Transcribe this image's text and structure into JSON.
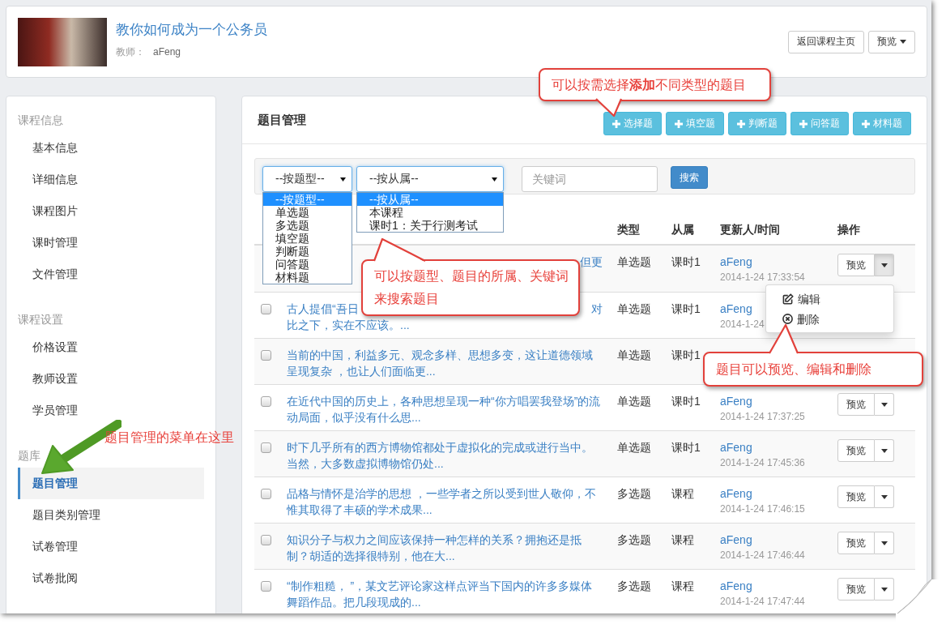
{
  "header": {
    "title": "教你如何成为一个公务员",
    "teacher_label": "教师：",
    "teacher": "aFeng",
    "buttons": [
      {
        "kind": "plain",
        "label": "返回课程主页"
      },
      {
        "kind": "dropdown",
        "label": "预览"
      }
    ]
  },
  "sidebar": {
    "groups": [
      {
        "heading": "课程信息",
        "items": [
          {
            "label": "基本信息",
            "selected": false
          },
          {
            "label": "详细信息",
            "selected": false
          },
          {
            "label": "课程图片",
            "selected": false
          },
          {
            "label": "课时管理",
            "selected": false
          },
          {
            "label": "文件管理",
            "selected": false
          }
        ]
      },
      {
        "heading": "课程设置",
        "items": [
          {
            "label": "价格设置",
            "selected": false
          },
          {
            "label": "教师设置",
            "selected": false
          },
          {
            "label": "学员管理",
            "selected": false
          }
        ]
      },
      {
        "heading": "题库",
        "items": [
          {
            "label": "题目管理",
            "selected": true
          },
          {
            "label": "题目类别管理",
            "selected": false
          },
          {
            "label": "试卷管理",
            "selected": false
          },
          {
            "label": "试卷批阅",
            "selected": false
          }
        ]
      }
    ]
  },
  "main": {
    "title": "题目管理",
    "add_buttons": [
      "选择题",
      "填空题",
      "判断题",
      "问答题",
      "材料题"
    ],
    "filters": {
      "selects": [
        {
          "value": "--按题型--",
          "expanded": true,
          "options": [
            {
              "label": "--按题型--",
              "selected": true
            },
            {
              "label": "单选题",
              "selected": false
            },
            {
              "label": "多选题",
              "selected": false
            },
            {
              "label": "填空题",
              "selected": false
            },
            {
              "label": "判断题",
              "selected": false
            },
            {
              "label": "问答题",
              "selected": false
            },
            {
              "label": "材料题",
              "selected": false
            }
          ]
        },
        {
          "value": "--按从属--",
          "expanded": true,
          "options": [
            {
              "label": "--按从属--",
              "selected": true
            },
            {
              "label": "本课程",
              "selected": false
            },
            {
              "label": "课时1：关于行测考试",
              "selected": false
            }
          ]
        }
      ],
      "keyword": {
        "placeholder": "关键词"
      },
      "search_button": "搜索"
    },
    "table": {
      "columns": [
        "类型",
        "从属",
        "更新人/时间",
        "操作"
      ],
      "rows": [
        {
          "lines": [
            {
              "end": "但更"
            }
          ],
          "type": "单选题",
          "scope": "课时1",
          "author": "aFeng",
          "time": "2014-1-24 17:33:54",
          "action": {
            "label": "预览",
            "expanded": true
          }
        },
        {
          "checked": false,
          "lines": [
            {
              "start": "古人提倡“吾日",
              "end": "对"
            },
            {
              "start": "比之下，实在不应该。..."
            }
          ],
          "type": "单选题",
          "scope": "课时1",
          "author": "aFeng",
          "time": "2014-1-24"
        },
        {
          "checked": false,
          "question": "当前的中国，利益多元、观念多样、思想多变，这让道德领域呈现复杂 ，也让人们面临更...",
          "type": "单选题",
          "scope": "课时1"
        },
        {
          "checked": false,
          "question": "在近代中国的历史上，各种思想呈现一种“你方唱罢我登场”的流动局面，似乎没有什么思...",
          "type": "单选题",
          "scope": "课时1",
          "author": "aFeng",
          "time": "2014-1-24 17:37:25",
          "action": {
            "label": "预览",
            "expanded": false
          }
        },
        {
          "checked": false,
          "question": "时下几乎所有的西方博物馆都处于虚拟化的完成或进行当中。当然，大多数虚拟博物馆仍处...",
          "type": "单选题",
          "scope": "课时1",
          "author": "aFeng",
          "time": "2014-1-24 17:45:36",
          "action": {
            "label": "预览",
            "expanded": false
          }
        },
        {
          "checked": false,
          "question": "品格与情怀是治学的思想 ，一些学者之所以受到世人敬仰，不惟其取得了丰硕的学术成果...",
          "type": "多选题",
          "scope": "课程",
          "author": "aFeng",
          "time": "2014-1-24 17:46:15",
          "action": {
            "label": "预览",
            "expanded": false
          }
        },
        {
          "checked": false,
          "question": "知识分子与权力之间应该保持一种怎样的关系？拥抱还是抵制？胡适的选择很特别，他在大...",
          "type": "多选题",
          "scope": "课程",
          "author": "aFeng",
          "time": "2014-1-24 17:46:44",
          "action": {
            "label": "预览",
            "expanded": false
          }
        },
        {
          "checked": false,
          "question": "“制作粗糙， ”，某文艺评论家这样点评当下国内的许多多媒体舞蹈作品。把几段现成的...",
          "type": "多选题",
          "scope": "课程",
          "author": "aFeng",
          "time": "2014-1-24 17:47:44",
          "action": {
            "label": "预览",
            "expanded": false
          }
        }
      ],
      "row_menu": [
        {
          "kind": "edit",
          "label": "编辑"
        },
        {
          "kind": "delete",
          "label": "删除"
        }
      ]
    }
  },
  "annotations": [
    {
      "kind": "callout",
      "text": "可以按需选择**添加**不同类型的题目"
    },
    {
      "kind": "callout",
      "text": "可以按题型、题目的所属、关键词来搜索题目"
    },
    {
      "kind": "callout",
      "text": "题目可以预览、编辑和删除"
    },
    {
      "kind": "arrow_note",
      "text": "题目管理的菜单在这里"
    }
  ]
}
